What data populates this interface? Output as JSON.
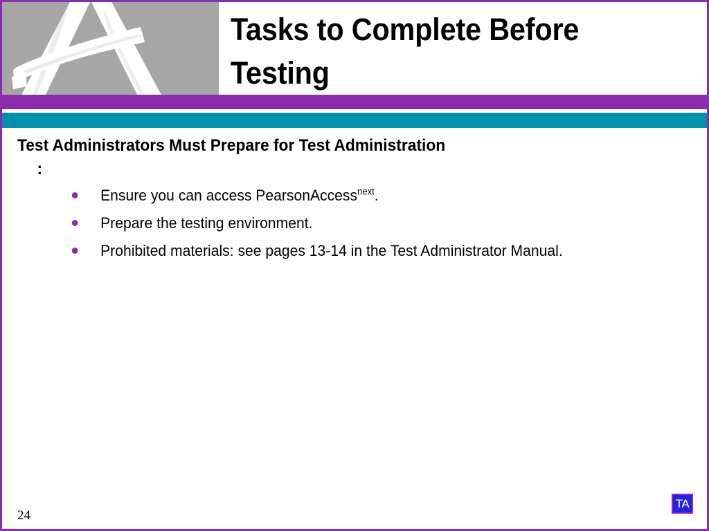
{
  "slide": {
    "logo_alt": "brushstroke-letter-A-logo",
    "title": "Tasks to Complete Before Testing",
    "lead_heading": "Test Administrators Must Prepare for Test Administration",
    "lead_colon": ":",
    "bullets": [
      {
        "text_before": "Ensure you can access PearsonAccess",
        "superscript": "next",
        "text_after": "."
      },
      {
        "text_before": "Prepare the testing environment.",
        "superscript": "",
        "text_after": ""
      },
      {
        "text_before": "Prohibited materials: see pages 13-14 in the Test Administrator Manual.",
        "superscript": "",
        "text_after": ""
      }
    ],
    "page_number": "24",
    "badge_label": "TA",
    "colors": {
      "purple": "#8B2BAE",
      "teal": "#0090AD",
      "logo_gray": "#A6A6A6",
      "bullet_purple": "#8A2BAE",
      "badge_blue": "#2323DE",
      "badge_border": "#9B25C6",
      "text_black": "#000000"
    }
  }
}
